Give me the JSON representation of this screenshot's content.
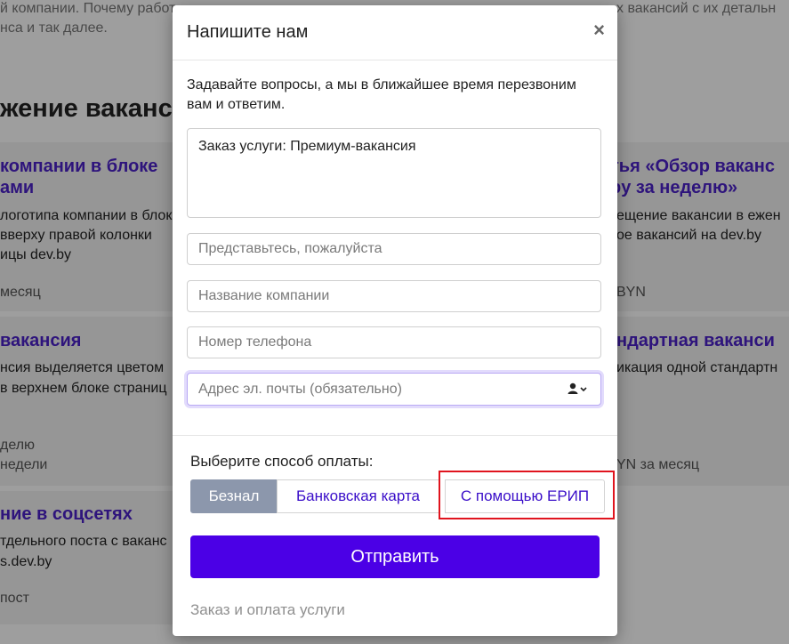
{
  "background": {
    "intro_left": "й компании. Почему работ",
    "intro_left_2": "нса и так далее.",
    "intro_right": "х вакансий с их детальн",
    "heading": "жение ваканси",
    "cards_left": [
      {
        "title1": "компании в блоке",
        "title2": "ами",
        "lines": [
          "логотипа компании в блок",
          "вверху правой колонки",
          "ицы dev.by"
        ],
        "price": "месяц"
      },
      {
        "title1": "вакансия",
        "title2": "",
        "lines": [
          "нсия выделяется цветом",
          "в верхнем блоке страниц"
        ],
        "price": "делю",
        "price2": "недели"
      },
      {
        "title1": "ние в соцсетях",
        "title2": "",
        "lines": [
          "тдельного поста с ваканс",
          "s.dev.by"
        ],
        "price": "пост"
      }
    ],
    "cards_right": [
      {
        "title1": "тья «Обзор ваканс",
        "title2": "by за неделю»",
        "lines": [
          "ещение вакансии в ежен",
          "ое вакансий на dev.by"
        ],
        "price": "BYN"
      },
      {
        "title1": "ндартная ваканси",
        "title2": "",
        "lines": [
          "икация одной стандартн"
        ],
        "price": "YN за месяц"
      }
    ]
  },
  "modal": {
    "title": "Напишите нам",
    "close_symbol": "×",
    "description": "Задавайте вопросы, а мы в ближайшее время перезвоним вам и ответим.",
    "message_value": "Заказ услуги: Премиум-вакансия",
    "name_placeholder": "Представьтесь, пожалуйста",
    "company_placeholder": "Название компании",
    "phone_placeholder": "Номер телефона",
    "email_placeholder": "Адрес эл. почты (обязательно)",
    "email_addon_icon": "person-icon",
    "payment_label": "Выберите способ оплаты:",
    "payment_options": [
      "Безнал",
      "Банковская карта",
      "С помощью ЕРИП"
    ],
    "payment_selected": "Безнал",
    "submit_label": "Отправить",
    "footer_link": "Заказ и оплата услуги"
  },
  "colors": {
    "accent": "#4b00e6",
    "link": "#3a0ec9",
    "active_tab": "#8c97ac",
    "highlight": "#e0141e"
  }
}
